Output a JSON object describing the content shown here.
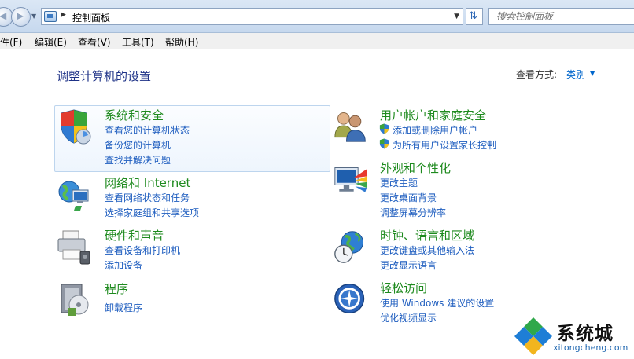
{
  "search": {
    "placeholder": "搜索控制面板"
  },
  "address": {
    "location": "控制面板"
  },
  "menu": {
    "file": "件(F)",
    "edit": "编辑(E)",
    "view": "查看(V)",
    "tools": "工具(T)",
    "help": "帮助(H)"
  },
  "page": {
    "title": "调整计算机的设置",
    "view_by_label": "查看方式:",
    "view_by_value": "类别"
  },
  "categories": {
    "security": {
      "title": "系统和安全",
      "links": [
        "查看您的计算机状态",
        "备份您的计算机",
        "查找并解决问题"
      ],
      "icon": "shield-icon"
    },
    "network": {
      "title": "网络和 Internet",
      "links": [
        "查看网络状态和任务",
        "选择家庭组和共享选项"
      ],
      "icon": "network-icon"
    },
    "hardware": {
      "title": "硬件和声音",
      "links": [
        "查看设备和打印机",
        "添加设备"
      ],
      "icon": "printer-icon"
    },
    "programs": {
      "title": "程序",
      "links": [
        "卸载程序"
      ],
      "icon": "programs-icon"
    },
    "users": {
      "title": "用户帐户和家庭安全",
      "links": [
        "添加或删除用户帐户",
        "为所有用户设置家长控制"
      ],
      "icon": "users-icon"
    },
    "appearance": {
      "title": "外观和个性化",
      "links": [
        "更改主题",
        "更改桌面背景",
        "调整屏幕分辨率"
      ],
      "icon": "monitor-icon"
    },
    "clock": {
      "title": "时钟、语言和区域",
      "links": [
        "更改键盘或其他输入法",
        "更改显示语言"
      ],
      "icon": "globe-clock-icon"
    },
    "access": {
      "title": "轻松访问",
      "links": [
        "使用 Windows 建议的设置",
        "优化视频显示"
      ],
      "icon": "accessibility-icon"
    }
  },
  "watermark": {
    "text": "系统城",
    "url": "xitongcheng.com"
  }
}
